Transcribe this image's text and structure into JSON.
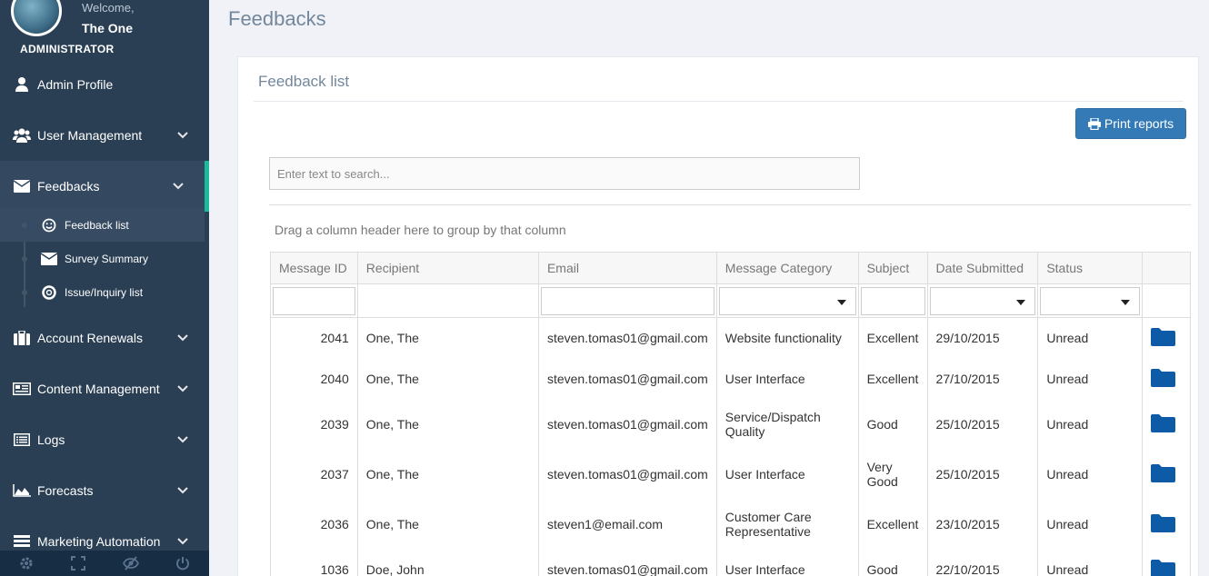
{
  "sidebar": {
    "welcome": "Welcome,",
    "username": "The One",
    "role": "ADMINISTRATOR",
    "items": [
      {
        "label": "Admin Profile",
        "icon": "user-icon"
      },
      {
        "label": "User Management",
        "icon": "users-icon"
      },
      {
        "label": "Feedbacks",
        "icon": "envelope-icon"
      },
      {
        "label": "Account Renewals",
        "icon": "briefcase-icon"
      },
      {
        "label": "Content Management",
        "icon": "newspaper-icon"
      },
      {
        "label": "Logs",
        "icon": "list-icon"
      },
      {
        "label": "Forecasts",
        "icon": "area-chart-icon"
      },
      {
        "label": "Marketing Automation",
        "icon": "tasks-icon"
      }
    ],
    "subitems": [
      {
        "label": "Feedback list",
        "icon": "smile-icon"
      },
      {
        "label": "Survey Summary",
        "icon": "envelope-icon"
      },
      {
        "label": "Issue/Inquiry list",
        "icon": "lifebuoy-icon"
      }
    ]
  },
  "page": {
    "title": "Feedbacks",
    "panel_title": "Feedback list",
    "print_label": "Print reports",
    "search_placeholder": "Enter text to search...",
    "group_hint": "Drag a column header here to group by that column"
  },
  "table": {
    "columns": [
      "Message ID",
      "Recipient",
      "Email",
      "Message Category",
      "Subject",
      "Date Submitted",
      "Status"
    ],
    "rows": [
      {
        "id": "2041",
        "recipient": "One, The",
        "email": "steven.tomas01@gmail.com",
        "category": "Website functionality",
        "subject": "Excellent",
        "date": "29/10/2015",
        "status": "Unread"
      },
      {
        "id": "2040",
        "recipient": "One, The",
        "email": "steven.tomas01@gmail.com",
        "category": "User Interface",
        "subject": "Excellent",
        "date": "27/10/2015",
        "status": "Unread"
      },
      {
        "id": "2039",
        "recipient": "One, The",
        "email": "steven.tomas01@gmail.com",
        "category": "Service/Dispatch Quality",
        "subject": "Good",
        "date": "25/10/2015",
        "status": "Unread"
      },
      {
        "id": "2037",
        "recipient": "One, The",
        "email": "steven.tomas01@gmail.com",
        "category": "User Interface",
        "subject": "Very Good",
        "date": "25/10/2015",
        "status": "Unread"
      },
      {
        "id": "2036",
        "recipient": "One, The",
        "email": "steven1@email.com",
        "category": "Customer Care Representative",
        "subject": "Excellent",
        "date": "23/10/2015",
        "status": "Unread"
      },
      {
        "id": "1036",
        "recipient": "Doe, John",
        "email": "steven.tomas01@gmail.com",
        "category": "User Interface",
        "subject": "Good",
        "date": "22/10/2015",
        "status": "Unread"
      }
    ]
  },
  "colors": {
    "sidebar": "#2a3f54",
    "accent": "#1abb9c",
    "primary": "#337ab7",
    "folder": "#0d5aa7"
  }
}
